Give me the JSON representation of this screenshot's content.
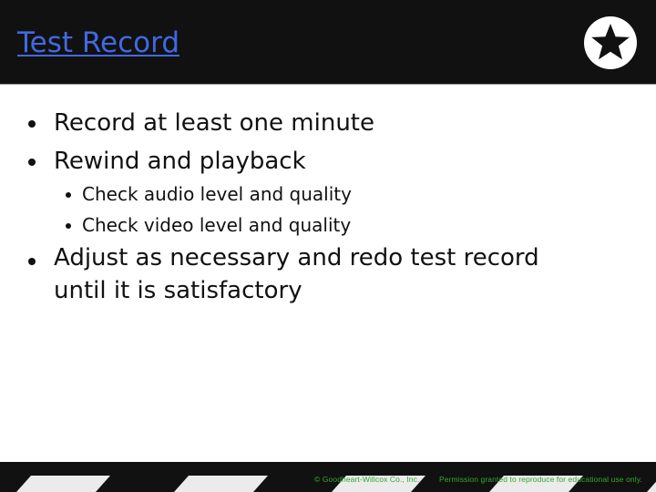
{
  "slide": {
    "title": "Test Record",
    "badge_icon": "star-icon",
    "bullets": [
      {
        "text": "Record at least one minute",
        "level": 1
      },
      {
        "text": "Rewind and playback",
        "level": 1
      },
      {
        "text": "Check audio level and quality",
        "level": 2
      },
      {
        "text": "Check video level and quality",
        "level": 2
      },
      {
        "text": "Adjust as necessary and redo test record",
        "continuation": "until it is satisfactory",
        "level": 1
      }
    ]
  },
  "footer": {
    "copyright": "© Goodheart-Willcox Co., Inc.",
    "permission": "Permission granted to reproduce for educational use only."
  },
  "colors": {
    "header_bg": "#111111",
    "title": "#4169e1",
    "footer_text": "#2eaa2e"
  }
}
